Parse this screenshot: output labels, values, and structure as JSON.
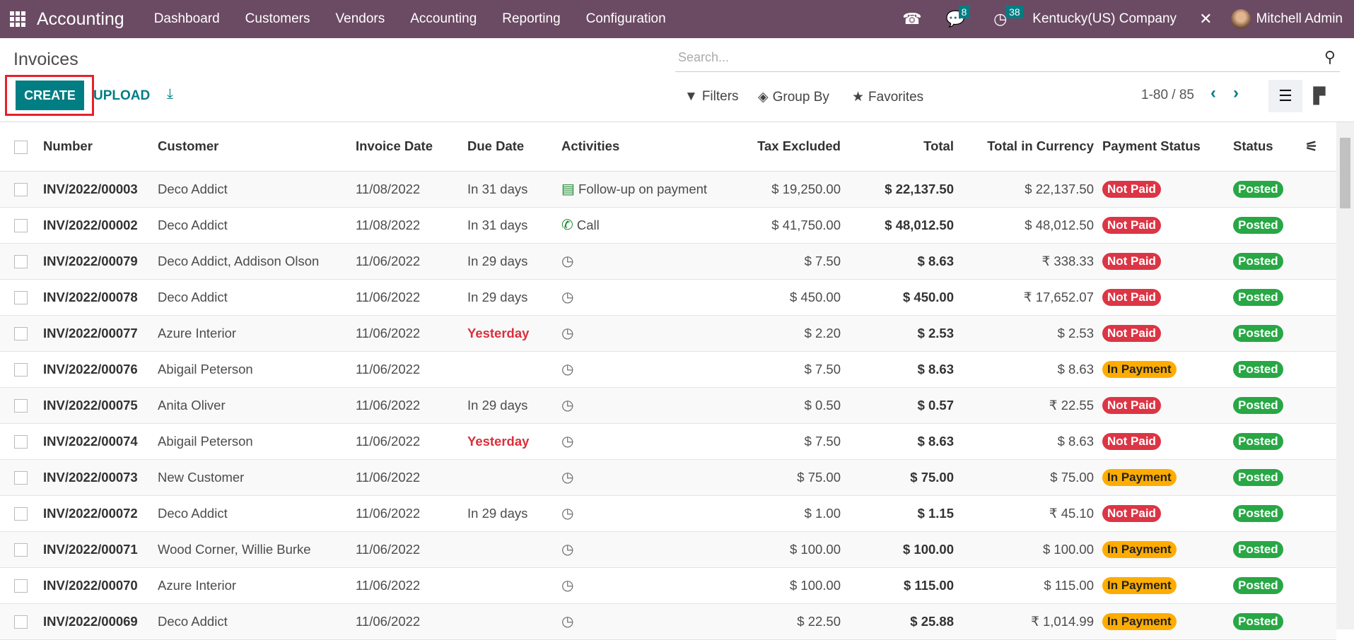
{
  "navbar": {
    "app": "Accounting",
    "menu": [
      "Dashboard",
      "Customers",
      "Vendors",
      "Accounting",
      "Reporting",
      "Configuration"
    ],
    "messages_count": "8",
    "activities_count": "38",
    "company": "Kentucky(US) Company",
    "user": "Mitchell Admin",
    "color": "#6b4a63"
  },
  "page": {
    "title": "Invoices",
    "search_placeholder": "Search...",
    "create": "CREATE",
    "upload": "UPLOAD",
    "filters": "Filters",
    "group_by": "Group By",
    "favorites": "Favorites",
    "pager": "1-80 / 85",
    "accent": "#017e84"
  },
  "columns": [
    "Number",
    "Customer",
    "Invoice Date",
    "Due Date",
    "Activities",
    "Tax Excluded",
    "Total",
    "Total in Currency",
    "Payment Status",
    "Status"
  ],
  "rows": [
    {
      "number": "INV/2022/00003",
      "customer": "Deco Addict",
      "date": "11/08/2022",
      "due": "In 31 days",
      "activity": "Follow-up on payment",
      "activity_icon": "list-icon",
      "tax": "$ 19,250.00",
      "total": "$ 22,137.50",
      "cur": "$ 22,137.50",
      "payment": "Not Paid",
      "status": "Posted"
    },
    {
      "number": "INV/2022/00002",
      "customer": "Deco Addict",
      "date": "11/08/2022",
      "due": "In 31 days",
      "activity": "Call",
      "activity_icon": "phone-icon",
      "tax": "$ 41,750.00",
      "total": "$ 48,012.50",
      "cur": "$ 48,012.50",
      "payment": "Not Paid",
      "status": "Posted"
    },
    {
      "number": "INV/2022/00079",
      "customer": "Deco Addict, Addison Olson",
      "date": "11/06/2022",
      "due": "In 29 days",
      "activity": "",
      "activity_icon": "clock-icon",
      "tax": "$ 7.50",
      "total": "$ 8.63",
      "cur": "₹ 338.33",
      "payment": "Not Paid",
      "status": "Posted"
    },
    {
      "number": "INV/2022/00078",
      "customer": "Deco Addict",
      "date": "11/06/2022",
      "due": "In 29 days",
      "activity": "",
      "activity_icon": "clock-icon",
      "tax": "$ 450.00",
      "total": "$ 450.00",
      "cur": "₹ 17,652.07",
      "payment": "Not Paid",
      "status": "Posted"
    },
    {
      "number": "INV/2022/00077",
      "customer": "Azure Interior",
      "date": "11/06/2022",
      "due": "Yesterday",
      "overdue": true,
      "activity": "",
      "activity_icon": "clock-icon",
      "tax": "$ 2.20",
      "total": "$ 2.53",
      "cur": "$ 2.53",
      "payment": "Not Paid",
      "status": "Posted"
    },
    {
      "number": "INV/2022/00076",
      "customer": "Abigail Peterson",
      "date": "11/06/2022",
      "due": "",
      "activity": "",
      "activity_icon": "clock-icon",
      "tax": "$ 7.50",
      "total": "$ 8.63",
      "cur": "$ 8.63",
      "payment": "In Payment",
      "status": "Posted"
    },
    {
      "number": "INV/2022/00075",
      "customer": "Anita Oliver",
      "date": "11/06/2022",
      "due": "In 29 days",
      "activity": "",
      "activity_icon": "clock-icon",
      "tax": "$ 0.50",
      "total": "$ 0.57",
      "cur": "₹ 22.55",
      "payment": "Not Paid",
      "status": "Posted"
    },
    {
      "number": "INV/2022/00074",
      "customer": "Abigail Peterson",
      "date": "11/06/2022",
      "due": "Yesterday",
      "overdue": true,
      "activity": "",
      "activity_icon": "clock-icon",
      "tax": "$ 7.50",
      "total": "$ 8.63",
      "cur": "$ 8.63",
      "payment": "Not Paid",
      "status": "Posted"
    },
    {
      "number": "INV/2022/00073",
      "customer": "New Customer",
      "date": "11/06/2022",
      "due": "",
      "activity": "",
      "activity_icon": "clock-icon",
      "tax": "$ 75.00",
      "total": "$ 75.00",
      "cur": "$ 75.00",
      "payment": "In Payment",
      "status": "Posted"
    },
    {
      "number": "INV/2022/00072",
      "customer": "Deco Addict",
      "date": "11/06/2022",
      "due": "In 29 days",
      "activity": "",
      "activity_icon": "clock-icon",
      "tax": "$ 1.00",
      "total": "$ 1.15",
      "cur": "₹ 45.10",
      "payment": "Not Paid",
      "status": "Posted"
    },
    {
      "number": "INV/2022/00071",
      "customer": "Wood Corner, Willie Burke",
      "date": "11/06/2022",
      "due": "",
      "activity": "",
      "activity_icon": "clock-icon",
      "tax": "$ 100.00",
      "total": "$ 100.00",
      "cur": "$ 100.00",
      "payment": "In Payment",
      "status": "Posted"
    },
    {
      "number": "INV/2022/00070",
      "customer": "Azure Interior",
      "date": "11/06/2022",
      "due": "",
      "activity": "",
      "activity_icon": "clock-icon",
      "tax": "$ 100.00",
      "total": "$ 115.00",
      "cur": "$ 115.00",
      "payment": "In Payment",
      "status": "Posted"
    },
    {
      "number": "INV/2022/00069",
      "customer": "Deco Addict",
      "date": "11/06/2022",
      "due": "",
      "activity": "",
      "activity_icon": "clock-icon",
      "tax": "$ 22.50",
      "total": "$ 25.88",
      "cur": "₹ 1,014.99",
      "payment": "In Payment",
      "status": "Posted"
    }
  ],
  "badge_colors": {
    "Not Paid": "#dc3545",
    "In Payment": "#ffac00",
    "Posted": "#28a745"
  }
}
